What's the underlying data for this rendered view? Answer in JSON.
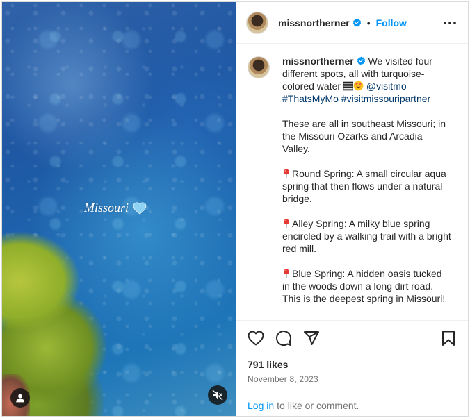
{
  "media": {
    "overlay_text": "Missouri",
    "overlay_emoji": "light-blue-heart-icon",
    "user_tag_icon": "person-icon",
    "mute_icon": "speaker-muted-icon"
  },
  "header": {
    "username": "missnortherner",
    "separator": "•",
    "follow_label": "Follow",
    "more_icon": "more-options-icon"
  },
  "caption": {
    "username": "missnortherner",
    "intro_text": " We visited four different spots, all with turquoise-colored water ",
    "mention": "@visitmo",
    "hashtag_1": "#ThatsMyMo",
    "hashtag_2": "#visitmissouripartner",
    "paragraph_2": "These are all in southeast Missouri; in the Missouri Ozarks and Arcadia Valley.",
    "spot_1": "Round Spring: A small circular aqua spring that then flows under a natural bridge.",
    "spot_2": "Alley Spring: A milky blue spring encircled by a walking trail with a bright red mill.",
    "spot_3": "Blue Spring: A hidden oasis tucked in the woods down a long dirt road. This is the deepest spring in Missouri!"
  },
  "actions": {
    "like_icon": "heart-icon",
    "comment_icon": "comment-icon",
    "share_icon": "share-icon",
    "save_icon": "bookmark-icon"
  },
  "stats": {
    "likes": "791 likes",
    "date": "November 8, 2023"
  },
  "footer": {
    "login_label": "Log in",
    "login_suffix": "to like or comment."
  },
  "colors": {
    "accent": "#0095f6",
    "link": "#00376b",
    "muted_text": "#737373"
  }
}
